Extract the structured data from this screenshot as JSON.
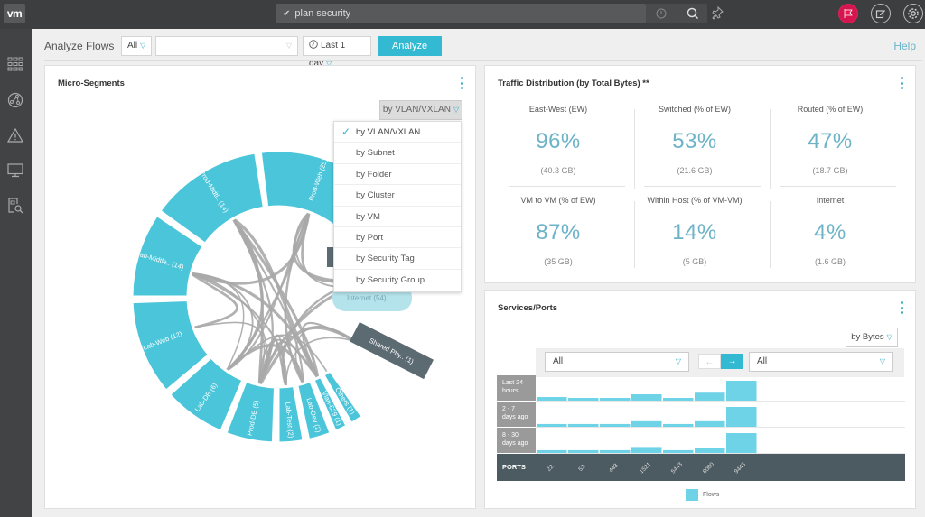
{
  "app": {
    "logo": "vm",
    "search_query": "plan security",
    "icons": {
      "search_history": "clock-icon",
      "search": "search-icon",
      "pin": "pin-icon",
      "notifications": "flag-icon",
      "feedback": "edit-icon",
      "settings": "gear-icon"
    }
  },
  "sidebar": {
    "items": [
      {
        "name": "dashboard",
        "icon": "grid-icon"
      },
      {
        "name": "plan-security",
        "icon": "network-icon"
      },
      {
        "name": "alerts",
        "icon": "warning-icon"
      },
      {
        "name": "infrastructure",
        "icon": "monitor-icon"
      },
      {
        "name": "search-analysis",
        "icon": "document-search-icon"
      }
    ]
  },
  "toolbar": {
    "title": "Analyze Flows",
    "scope_select": "All",
    "entity_select": "",
    "time_range": "Last 1 day",
    "analyze_label": "Analyze",
    "help_label": "Help"
  },
  "micro_segments": {
    "title": "Micro-Segments",
    "group_by": "by VLAN/VXLAN",
    "group_by_options": [
      {
        "label": "by VLAN/VXLAN",
        "selected": true
      },
      {
        "label": "by Subnet",
        "selected": false
      },
      {
        "label": "by Folder",
        "selected": false
      },
      {
        "label": "by Cluster",
        "selected": false
      },
      {
        "label": "by VM",
        "selected": false
      },
      {
        "label": "by Port",
        "selected": false
      },
      {
        "label": "by Security Tag",
        "selected": false
      },
      {
        "label": "by Security Group",
        "selected": false
      }
    ],
    "segments": [
      {
        "label": "Prod-Web (25)",
        "count": 25,
        "kind": "vlan"
      },
      {
        "label": "Prod-Midtl.. (14)",
        "count": 14,
        "kind": "vlan"
      },
      {
        "label": "Lab-Midtle.. (14)",
        "count": 14,
        "kind": "vlan"
      },
      {
        "label": "Lab-Web (12)",
        "count": 12,
        "kind": "vlan"
      },
      {
        "label": "Lab-DB (6)",
        "count": 6,
        "kind": "vlan"
      },
      {
        "label": "Prod-DB (5)",
        "count": 5,
        "kind": "vlan"
      },
      {
        "label": "Lab-Test (2)",
        "count": 2,
        "kind": "vlan"
      },
      {
        "label": "Lab-Dev (2)",
        "count": 2,
        "kind": "vlan"
      },
      {
        "label": "Vlan-629 (1)",
        "count": 1,
        "kind": "vlan"
      },
      {
        "label": "Others (1)",
        "count": 1,
        "kind": "vlan"
      },
      {
        "label": "Shared Phy.. (1)",
        "count": 1,
        "kind": "physical"
      }
    ],
    "internet_label": "Internet (54)",
    "colors": {
      "vlan": "#4ac5d9",
      "physical": "#5c6a72",
      "internet": "#b4e3ec",
      "links": "#a9a9a9"
    }
  },
  "traffic_distribution": {
    "title": "Traffic Distribution (by Total Bytes) **",
    "stats": [
      {
        "label": "East-West (EW)",
        "value": "96%",
        "sub": "(40.3 GB)"
      },
      {
        "label": "Switched (% of EW)",
        "value": "53%",
        "sub": "(21.6 GB)"
      },
      {
        "label": "Routed (% of EW)",
        "value": "47%",
        "sub": "(18.7 GB)"
      },
      {
        "label": "VM to VM (% of EW)",
        "value": "87%",
        "sub": "(35 GB)"
      },
      {
        "label": "Within Host (% of VM-VM)",
        "value": "14%",
        "sub": "(5 GB)"
      },
      {
        "label": "Internet",
        "value": "4%",
        "sub": "(1.6 GB)"
      }
    ]
  },
  "services_ports": {
    "title": "Services/Ports",
    "metric": "by Bytes",
    "source_filter": "All",
    "dest_filter": "All",
    "axis_label": "PORTS",
    "legend": "Flows",
    "colors": {
      "bar": "#6fd3e8",
      "row_header": "#9a9a9a",
      "axis": "#4c5a61"
    },
    "chart_data": {
      "type": "bar",
      "categories": [
        "22",
        "53",
        "443",
        "1521",
        "5443",
        "8080",
        "9443"
      ],
      "rows": [
        {
          "label": "Last 24 hours",
          "lines": [
            "Last 24",
            "hours"
          ],
          "values": [
            0.18,
            0.12,
            0.12,
            0.32,
            0.12,
            0.4,
            1.0
          ]
        },
        {
          "label": "2 - 7 days ago",
          "lines": [
            "2 - 7",
            "days ago"
          ],
          "values": [
            0.14,
            0.14,
            0.14,
            0.28,
            0.14,
            0.28,
            1.0
          ]
        },
        {
          "label": "8 - 30 days ago",
          "lines": [
            "8 - 30",
            "days ago"
          ],
          "values": [
            0.14,
            0.14,
            0.14,
            0.3,
            0.14,
            0.24,
            1.0
          ]
        }
      ],
      "series": [
        {
          "name": "Flows"
        }
      ],
      "ylim": [
        0,
        1
      ]
    }
  }
}
